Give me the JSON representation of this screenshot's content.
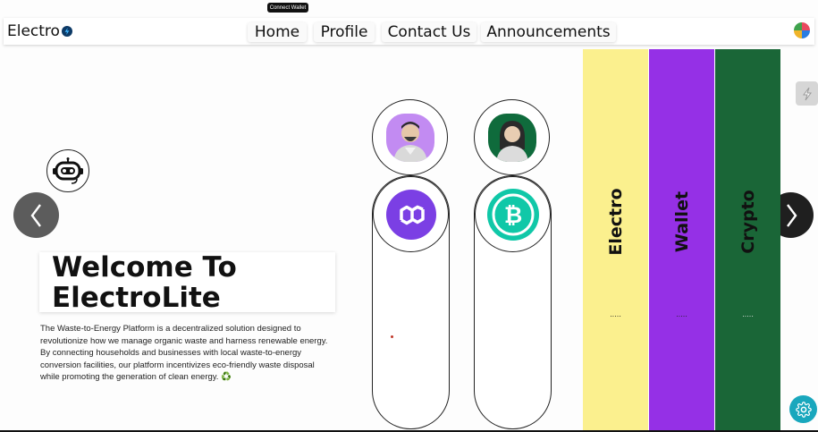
{
  "header": {
    "connect_wallet": "Connect Wallet",
    "brand": "Electro",
    "nav": [
      "Home",
      "Profile",
      "Contact Us",
      "Announcements"
    ]
  },
  "hero": {
    "title": "Welcome To\nElectroLite",
    "description": "The Waste-to-Energy Platform is a decentralized solution designed to revolutionize how we manage organic waste and harness renewable energy. By connecting households and businesses with local waste-to-energy conversion facilities, our platform incentivizes eco-friendly waste disposal while promoting the generation of clean energy. ♻️"
  },
  "panels": [
    {
      "label": "Electro",
      "dots": ".....",
      "color": "#fbf08e"
    },
    {
      "label": "Wallet",
      "dots": ".....",
      "color": "#9530e6"
    },
    {
      "label": "Crypto",
      "dots": ".....",
      "color": "#1a6637"
    }
  ],
  "colors": {
    "polygon": "#7b3fe4",
    "bitcoin_cash": "#10c8a8",
    "person1_bg": "#c28bf2",
    "person2_bg": "#0f6b3c",
    "settings": "#19a7bd"
  },
  "icons": {
    "carousel_prev": "chevron-left-icon",
    "carousel_next": "chevron-right-icon",
    "chatbot": "robot-icon",
    "settings": "gear-icon"
  }
}
